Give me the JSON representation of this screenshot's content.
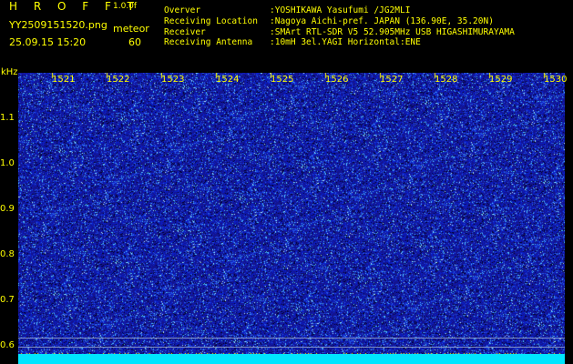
{
  "header": {
    "title": "H R O F F T",
    "version": "1.0.0f",
    "filename": "YY2509151520.png",
    "mode": "meteor",
    "datetime": "25.09.15 15:20",
    "count": "60"
  },
  "station": {
    "observer_label": "Overver",
    "observer": ":YOSHIKAWA Yasufumi /JG2MLI",
    "location_label": "Receiving Location",
    "location": ":Nagoya Aichi-pref. JAPAN (136.90E, 35.20N)",
    "receiver_label": "Receiver",
    "receiver": ":SMArt RTL-SDR V5 52.905MHz USB HIGASHIMURAYAMA",
    "antenna_label": "Receiving Antenna",
    "antenna": ":10mH 3el.YAGI Horizontal:ENE"
  },
  "axis": {
    "y_unit": "kHz",
    "y_ticks": [
      "1.1",
      "1.0",
      "0.9",
      "0.8",
      "0.7",
      "0.6"
    ],
    "x_ticks": [
      "1521",
      "1522",
      "1523",
      "1524",
      "1525",
      "1526",
      "1527",
      "1528",
      "1529",
      "1530"
    ]
  },
  "colors": {
    "background": "#000000",
    "text": "#ffff00",
    "spectrum": "#14148e",
    "band": "#00e5ff"
  }
}
